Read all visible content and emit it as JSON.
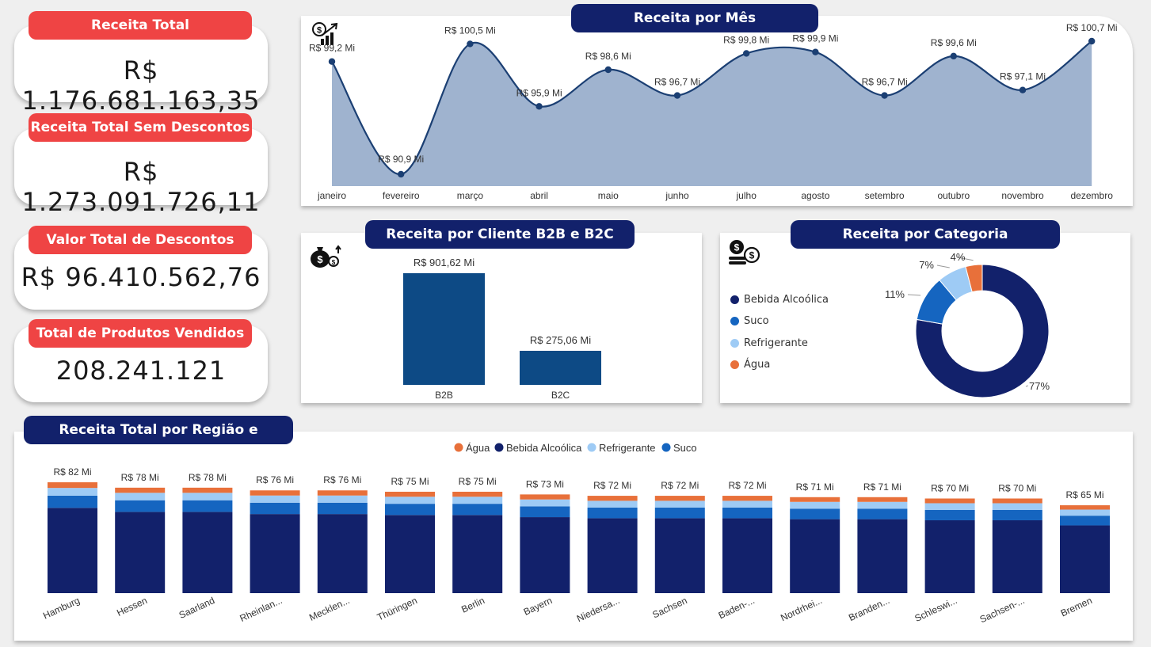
{
  "kpis": [
    {
      "label": "Receita Total",
      "value": "R$ 1.176.681.163,35"
    },
    {
      "label": "Receita Total Sem Descontos",
      "value": "R$ 1.273.091.726,11"
    },
    {
      "label": "Valor Total de Descontos",
      "value": "R$ 96.410.562,76"
    },
    {
      "label": "Total de Produtos Vendidos",
      "value": "208.241.121"
    }
  ],
  "colors": {
    "kpi_label": "#ef4444",
    "title_pill": "#12216b",
    "bebida": "#12216b",
    "suco": "#1565c0",
    "refrigerante": "#9ecbf5",
    "agua": "#e8703a",
    "area_fill": "#9fb3cf",
    "line": "#1b3f73",
    "b2_bar": "#0d4a85"
  },
  "chart_data": [
    {
      "type": "area",
      "title": "Receita por Mês",
      "icon": "money-growth-icon",
      "categories": [
        "janeiro",
        "fevereiro",
        "março",
        "abril",
        "maio",
        "junho",
        "julho",
        "agosto",
        "setembro",
        "outubro",
        "novembro",
        "dezembro"
      ],
      "values": [
        99.2,
        90.9,
        100.5,
        95.9,
        98.6,
        96.7,
        99.8,
        99.9,
        96.7,
        99.6,
        97.1,
        100.7
      ],
      "labels": [
        "R$ 99,2 Mi",
        "R$ 90,9 Mi",
        "R$ 100,5 Mi",
        "R$ 95,9 Mi",
        "R$ 98,6 Mi",
        "R$ 96,7 Mi",
        "R$ 99,8 Mi",
        "R$ 99,9 Mi",
        "R$ 96,7 Mi",
        "R$ 99,6 Mi",
        "R$ 97,1 Mi",
        "R$ 100,7 Mi"
      ],
      "ylim": [
        90.9,
        100.7
      ]
    },
    {
      "type": "bar",
      "title": "Receita por Cliente B2B e B2C",
      "icon": "money-bag-icon",
      "categories": [
        "B2B",
        "B2C"
      ],
      "values": [
        901.62,
        275.06
      ],
      "labels": [
        "R$ 901,62 Mi",
        "R$ 275,06 Mi"
      ],
      "ylim": [
        0,
        901.62
      ]
    },
    {
      "type": "pie",
      "title": "Receita por Categoria",
      "icon": "coins-icon",
      "categories": [
        "Bebida Alcoólica",
        "Suco",
        "Refrigerante",
        "Água"
      ],
      "values": [
        77,
        11,
        7,
        4
      ],
      "labels": [
        "77%",
        "11%",
        "7%",
        "4%"
      ]
    },
    {
      "type": "bar",
      "stacked": true,
      "title": "Receita Total por Região e Categoria",
      "legend": [
        "Água",
        "Bebida Alcoólica",
        "Refrigerante",
        "Suco"
      ],
      "categories": [
        "Hamburg",
        "Hessen",
        "Saarland",
        "Rheinlan...",
        "Mecklen...",
        "Thüringen",
        "Berlin",
        "Bayern",
        "Niedersa...",
        "Sachsen",
        "Baden-...",
        "Nordrhei...",
        "Branden...",
        "Schleswi...",
        "Sachsen-...",
        "Bremen"
      ],
      "totals": [
        82,
        78,
        78,
        76,
        76,
        75,
        75,
        73,
        72,
        72,
        72,
        71,
        71,
        70,
        70,
        65
      ],
      "total_labels": [
        "R$ 82 Mi",
        "R$ 78 Mi",
        "R$ 78 Mi",
        "R$ 76 Mi",
        "R$ 76 Mi",
        "R$ 75 Mi",
        "R$ 75 Mi",
        "R$ 73 Mi",
        "R$ 72 Mi",
        "R$ 72 Mi",
        "R$ 72 Mi",
        "R$ 71 Mi",
        "R$ 71 Mi",
        "R$ 70 Mi",
        "R$ 70 Mi",
        "R$ 65 Mi"
      ],
      "series": [
        {
          "name": "Bebida Alcoólica",
          "values": [
            63.1,
            60.1,
            60.1,
            58.5,
            58.5,
            57.8,
            57.8,
            56.2,
            55.4,
            55.4,
            55.4,
            54.7,
            54.7,
            53.9,
            53.9,
            50.1
          ]
        },
        {
          "name": "Suco",
          "values": [
            9.0,
            8.6,
            8.6,
            8.4,
            8.4,
            8.3,
            8.3,
            8.0,
            7.9,
            7.9,
            7.9,
            7.8,
            7.8,
            7.7,
            7.7,
            7.2
          ]
        },
        {
          "name": "Refrigerante",
          "values": [
            5.7,
            5.5,
            5.5,
            5.3,
            5.3,
            5.2,
            5.2,
            5.1,
            5.0,
            5.0,
            5.0,
            5.0,
            5.0,
            4.9,
            4.9,
            4.5
          ]
        },
        {
          "name": "Água",
          "values": [
            4.2,
            3.8,
            3.8,
            3.8,
            3.8,
            3.7,
            3.7,
            3.7,
            3.7,
            3.7,
            3.7,
            3.5,
            3.5,
            3.5,
            3.5,
            3.2
          ]
        }
      ],
      "ylim": [
        0,
        82
      ]
    }
  ]
}
